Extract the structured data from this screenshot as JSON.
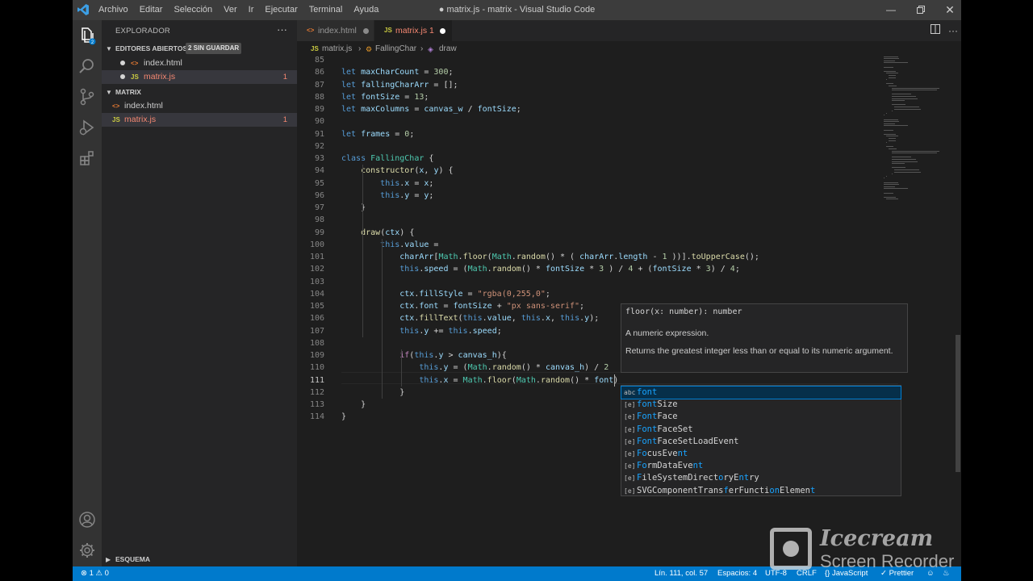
{
  "window": {
    "title": "● matrix.js - matrix - Visual Studio Code",
    "menus": [
      "Archivo",
      "Editar",
      "Selección",
      "Ver",
      "Ir",
      "Ejecutar",
      "Terminal",
      "Ayuda"
    ]
  },
  "sidebar": {
    "header": "EXPLORADOR",
    "open_editors": {
      "title": "EDITORES ABIERTOS",
      "badge": "2 SIN GUARDAR",
      "items": [
        {
          "icon": "<>",
          "name": "index.html",
          "count": ""
        },
        {
          "icon": "JS",
          "name": "matrix.js",
          "count": "1"
        }
      ]
    },
    "folder": {
      "title": "MATRIX",
      "items": [
        {
          "icon": "<>",
          "name": "index.html",
          "count": ""
        },
        {
          "icon": "JS",
          "name": "matrix.js",
          "count": "1"
        }
      ]
    },
    "outline": "ESQUEMA"
  },
  "tabs": [
    {
      "icon": "<>",
      "name": "index.html",
      "active": false
    },
    {
      "icon": "JS",
      "name": "matrix.js",
      "badge": "1",
      "active": true
    }
  ],
  "breadcrumbs": {
    "file_icon": "JS",
    "file": "matrix.js",
    "class": "FallingChar",
    "method": "draw"
  },
  "editor": {
    "lines": [
      {
        "n": "85",
        "code": ""
      },
      {
        "n": "86",
        "code": "let maxCharCount = 300;"
      },
      {
        "n": "87",
        "code": "let fallingCharArr = [];"
      },
      {
        "n": "88",
        "code": "let fontSize = 13;"
      },
      {
        "n": "89",
        "code": "let maxColumns = canvas_w / fontSize;"
      },
      {
        "n": "90",
        "code": ""
      },
      {
        "n": "91",
        "code": "let frames = 0;"
      },
      {
        "n": "92",
        "code": ""
      },
      {
        "n": "93",
        "code": "class FallingChar {"
      },
      {
        "n": "94",
        "code": "    constructor(x, y) {"
      },
      {
        "n": "95",
        "code": "        this.x = x;"
      },
      {
        "n": "96",
        "code": "        this.y = y;"
      },
      {
        "n": "97",
        "code": "    }"
      },
      {
        "n": "98",
        "code": ""
      },
      {
        "n": "99",
        "code": "    draw(ctx) {"
      },
      {
        "n": "100",
        "code": "        this.value ="
      },
      {
        "n": "101",
        "code": "            charArr[Math.floor(Math.random() * ( charArr.length - 1 ))].toUpperCase();"
      },
      {
        "n": "102",
        "code": "            this.speed = (Math.random() * fontSize * 3 ) / 4 + (fontSize * 3) / 4;"
      },
      {
        "n": "103",
        "code": ""
      },
      {
        "n": "104",
        "code": "            ctx.fillStyle = \"rgba(0,255,0\";"
      },
      {
        "n": "105",
        "code": "            ctx.font = fontSize + \"px sans-serif\";"
      },
      {
        "n": "106",
        "code": "            ctx.fillText(this.value, this.x, this.y);"
      },
      {
        "n": "107",
        "code": "            this.y += this.speed;"
      },
      {
        "n": "108",
        "code": ""
      },
      {
        "n": "109",
        "code": "            if(this.y > canvas_h){"
      },
      {
        "n": "110",
        "code": "                this.y = (Math.random() * canvas_h) / 2"
      },
      {
        "n": "111",
        "code": "                this.x = Math.floor(Math.random() * font)"
      },
      {
        "n": "112",
        "code": "            }"
      },
      {
        "n": "113",
        "code": "    }"
      },
      {
        "n": "114",
        "code": "}"
      }
    ]
  },
  "hover": {
    "signature": "floor(x: number): number",
    "param": "A numeric expression.",
    "description": "Returns the greatest integer less than or equal to its numeric argument."
  },
  "suggestions": [
    {
      "kind": "abc",
      "label": "font",
      "selected": true
    },
    {
      "kind": "[e]",
      "label": "fontSize"
    },
    {
      "kind": "[e]",
      "label": "FontFace"
    },
    {
      "kind": "[e]",
      "label": "FontFaceSet"
    },
    {
      "kind": "[e]",
      "label": "FontFaceSetLoadEvent"
    },
    {
      "kind": "[e]",
      "label": "FocusEvent"
    },
    {
      "kind": "[e]",
      "label": "FormDataEvent"
    },
    {
      "kind": "[e]",
      "label": "FileSystemDirectoryEntry"
    },
    {
      "kind": "[e]",
      "label": "SVGComponentTransferFunctionElement"
    }
  ],
  "status": {
    "problems": "⊗ 1 ⚠ 0",
    "position": "Lín. 111, col. 57",
    "spaces": "Espacios: 4",
    "encoding": "UTF-8",
    "eol": "CRLF",
    "language": "{} JavaScript",
    "prettier": "✓ Prettier"
  },
  "watermark": {
    "line1": "Icecream",
    "line2": "Screen Recorder"
  },
  "colors": {
    "accent": "#007acc",
    "keyword": "#569cd6",
    "string": "#ce9178",
    "number": "#b5cea8"
  }
}
